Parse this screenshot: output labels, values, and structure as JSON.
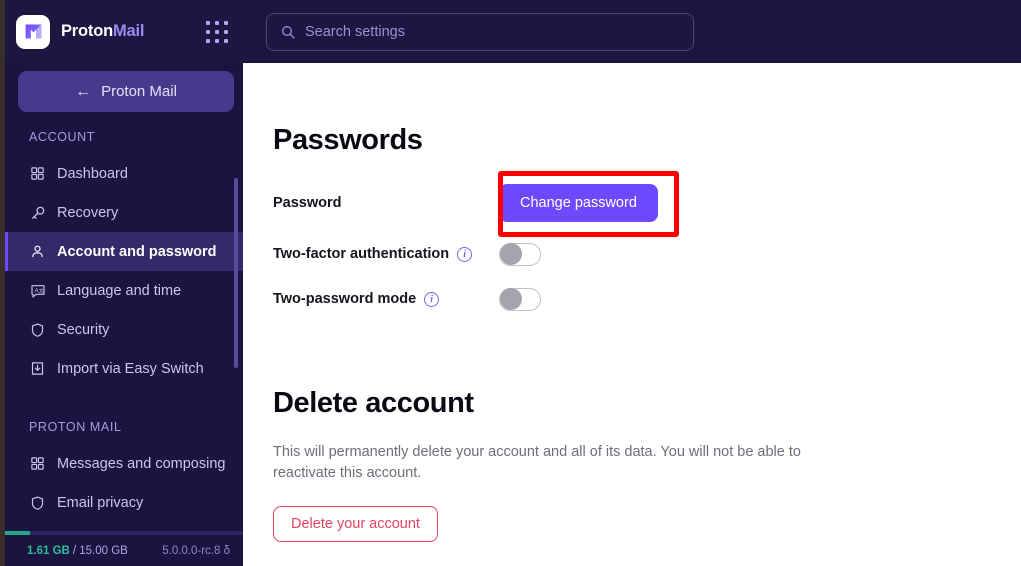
{
  "brand": {
    "word1": "Proton",
    "word2": "Mail",
    "logo_icon": "proton-mail-envelope-icon",
    "apps_icon": "apps-grid-icon"
  },
  "search": {
    "placeholder": "Search settings",
    "value": "",
    "icon": "search-icon"
  },
  "sidebar": {
    "back_label": "Proton Mail",
    "back_icon": "arrow-left-icon",
    "sections": [
      {
        "label": "ACCOUNT",
        "items": [
          {
            "label": "Dashboard",
            "icon": "grid-icon",
            "active": false
          },
          {
            "label": "Recovery",
            "icon": "key-icon",
            "active": false
          },
          {
            "label": "Account and password",
            "icon": "user-icon",
            "active": true
          },
          {
            "label": "Language and time",
            "icon": "translate-icon",
            "active": false
          },
          {
            "label": "Security",
            "icon": "shield-icon",
            "active": false
          },
          {
            "label": "Import via Easy Switch",
            "icon": "import-download-icon",
            "active": false
          }
        ]
      },
      {
        "label": "PROTON MAIL",
        "items": [
          {
            "label": "Messages and composing",
            "icon": "grid-icon",
            "active": false
          },
          {
            "label": "Email privacy",
            "icon": "shield-icon",
            "active": false
          }
        ]
      }
    ],
    "storage": {
      "used": "1.61 GB",
      "separator": "/",
      "total": "15.00 GB",
      "percent": 10.7,
      "version": "5.0.0.0-rc.8 δ"
    }
  },
  "main": {
    "passwords": {
      "title": "Passwords",
      "rows": [
        {
          "label": "Password",
          "control": "button",
          "button_label": "Change password",
          "highlighted": true
        },
        {
          "label": "Two-factor authentication",
          "control": "toggle",
          "info_icon": "info-icon",
          "toggle_on": false
        },
        {
          "label": "Two-password mode",
          "control": "toggle",
          "info_icon": "info-icon",
          "toggle_on": false
        }
      ]
    },
    "delete_account": {
      "title": "Delete account",
      "description": "This will permanently delete your account and all of its data. You will not be able to reactivate this account.",
      "button_label": "Delete your account"
    }
  },
  "colors": {
    "brand_purple": "#6d4aff",
    "sidebar_bg": "#1b1340",
    "header_bg": "#1c1740",
    "active_item_bg": "#342a6b",
    "danger_red": "#e5435f",
    "annotation_red": "#ff0000",
    "storage_green": "#1ea885"
  }
}
